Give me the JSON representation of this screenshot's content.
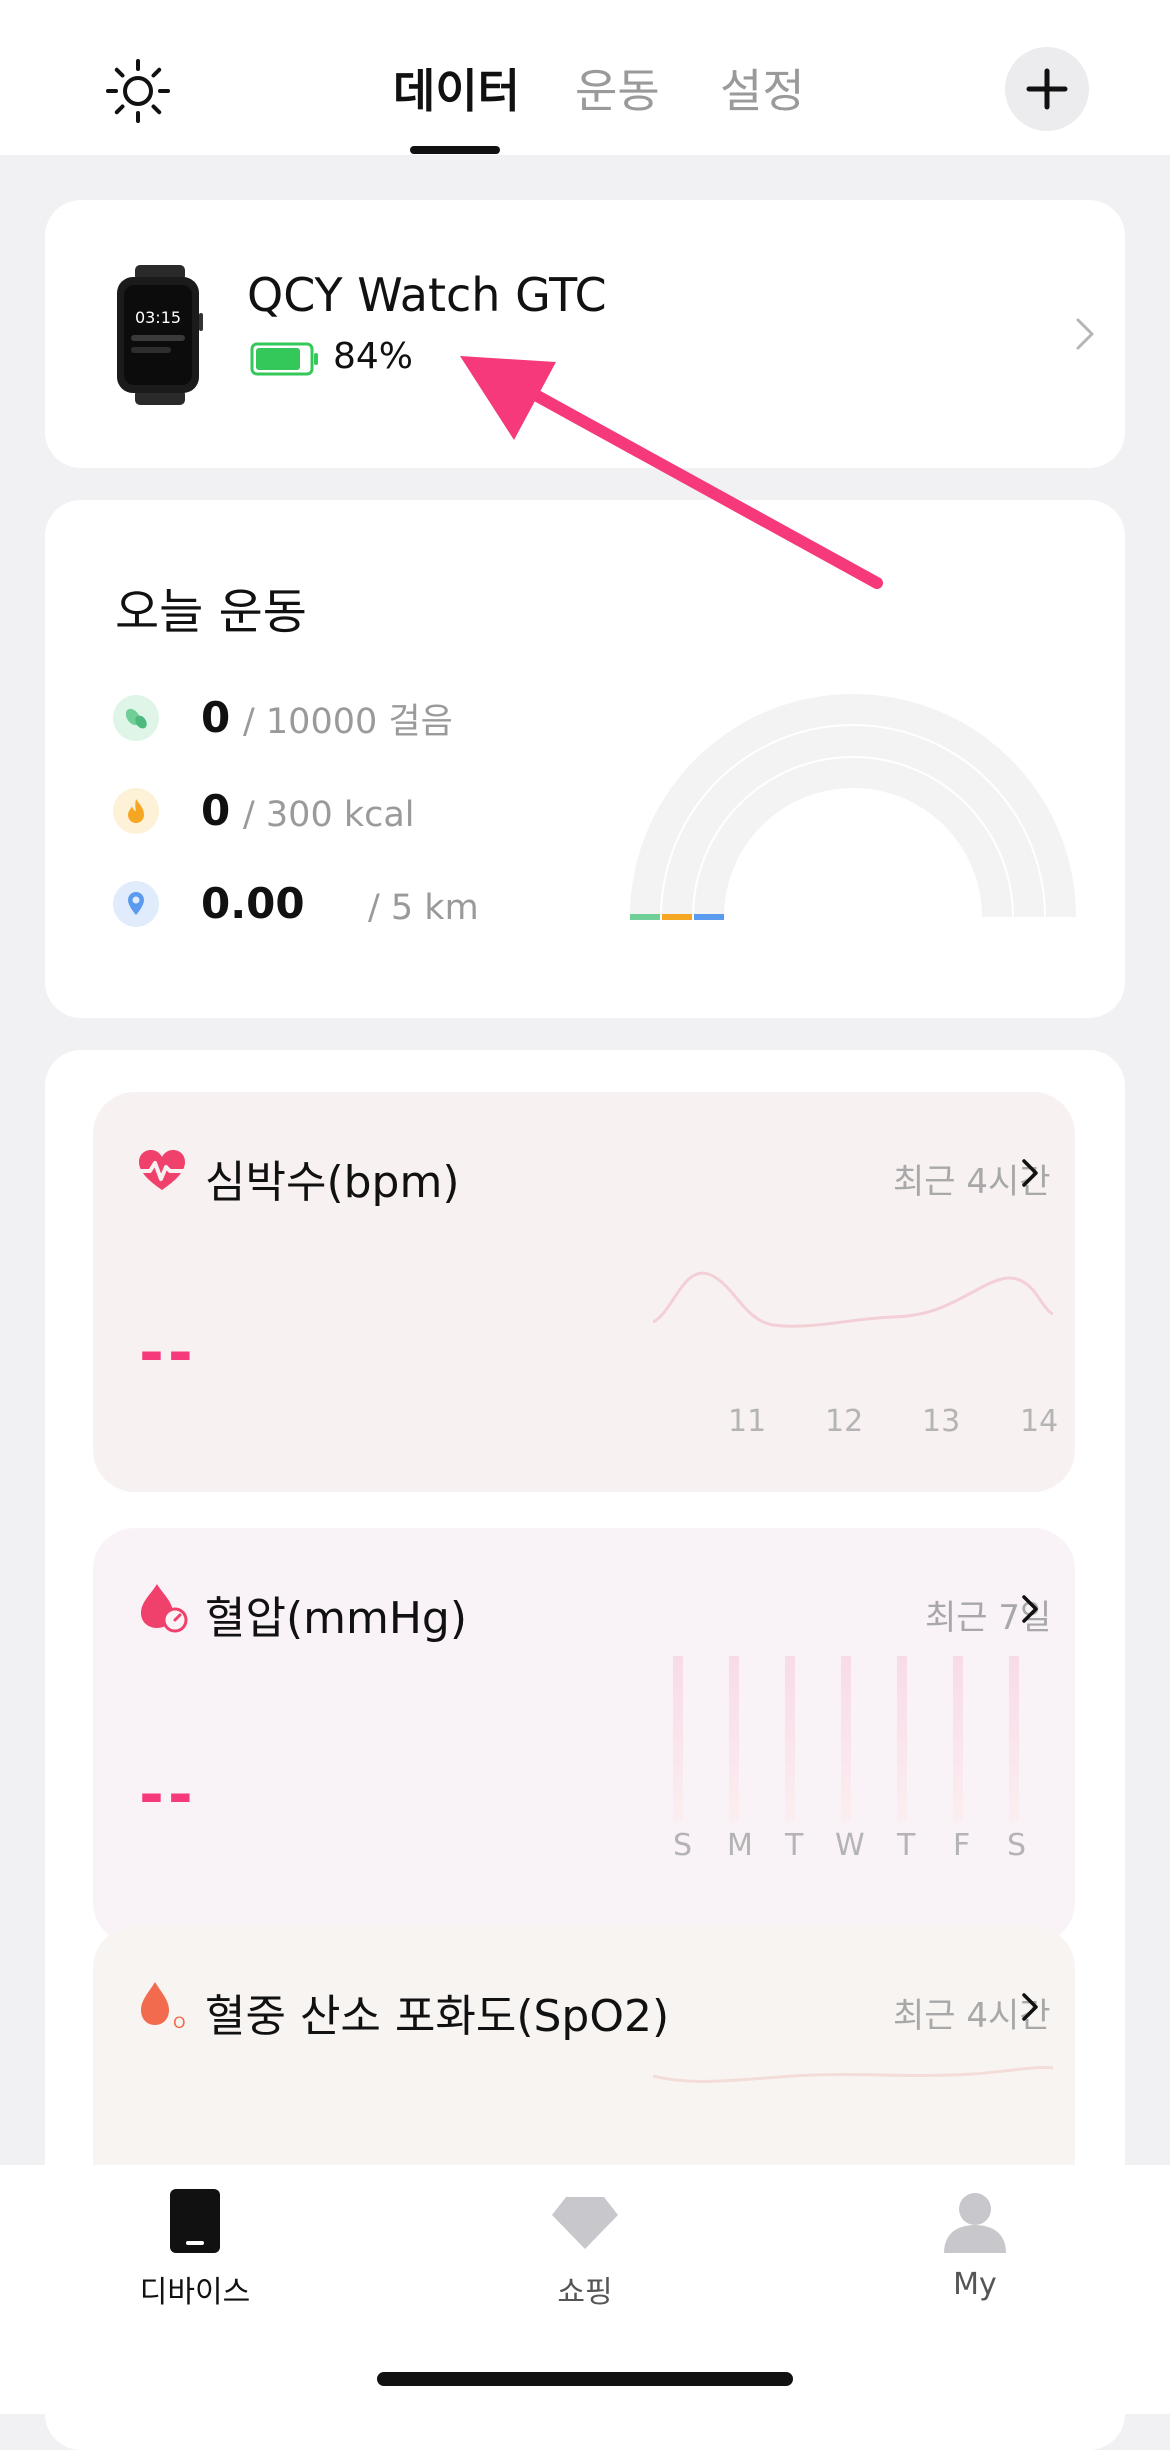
{
  "colors": {
    "accent": "#f5397a",
    "battery_green": "#34c759",
    "steps_green": "#6fcf97",
    "calorie_orange": "#f5a623",
    "distance_blue": "#5b9bef",
    "heart_pink": "#f0416c"
  },
  "header": {
    "tabs": [
      {
        "label": "데이터",
        "active": true
      },
      {
        "label": "운동",
        "active": false
      },
      {
        "label": "설정",
        "active": false
      }
    ],
    "left_icon": "sun-icon",
    "right_icon": "plus-icon"
  },
  "device": {
    "name": "QCY Watch GTC",
    "battery_percent_text": "84%",
    "battery_level": 0.84,
    "watch_time": "03:15"
  },
  "exercise": {
    "title": "오늘 운동",
    "rows": [
      {
        "icon": "footsteps-icon",
        "value": "0",
        "goal": "/ 10000 걸음"
      },
      {
        "icon": "flame-icon",
        "value": "0",
        "goal": "/ 300 kcal"
      },
      {
        "icon": "location-pin-icon",
        "value": "0.00",
        "goal": "/ 5 km"
      }
    ]
  },
  "metrics": {
    "heart_rate": {
      "title": "심박수(bpm)",
      "range": "최근 4시간",
      "value": "--",
      "ticks": [
        "11",
        "12",
        "13",
        "14"
      ]
    },
    "blood_pressure": {
      "title": "혈압(mmHg)",
      "range": "최근 7일",
      "value": "--",
      "days": [
        "S",
        "M",
        "T",
        "W",
        "T",
        "F",
        "S"
      ]
    },
    "spo2": {
      "title": "혈중 산소 포화도(SpO2)",
      "range": "최근 4시간"
    }
  },
  "bottom_nav": [
    {
      "label": "디바이스",
      "icon": "device-icon",
      "active": true
    },
    {
      "label": "쇼핑",
      "icon": "diamond-icon",
      "active": false
    },
    {
      "label": "My",
      "icon": "profile-icon",
      "active": false
    }
  ]
}
